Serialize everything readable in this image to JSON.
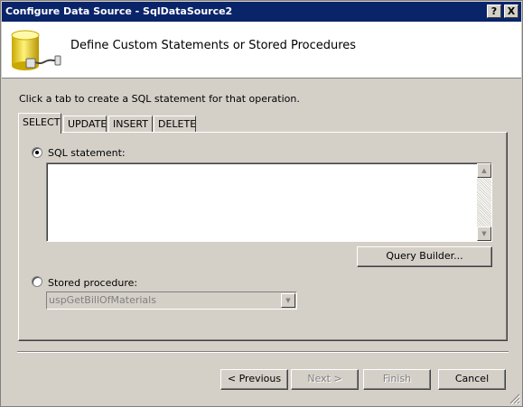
{
  "window": {
    "title": "Configure Data Source - SqlDataSource2",
    "help_label": "?",
    "close_label": "X"
  },
  "header": {
    "heading": "Define Custom Statements or Stored Procedures",
    "icon": "database-connection-icon"
  },
  "instruction": "Click a tab to create a SQL statement for that operation.",
  "tabs": [
    {
      "label": "SELECT",
      "active": true
    },
    {
      "label": "UPDATE",
      "active": false
    },
    {
      "label": "INSERT",
      "active": false
    },
    {
      "label": "DELETE",
      "active": false
    }
  ],
  "sql_option": {
    "label": "SQL statement:",
    "selected": true,
    "value": ""
  },
  "query_builder_label": "Query Builder...",
  "stored_proc_option": {
    "label": "Stored procedure:",
    "selected": false,
    "selected_value": "uspGetBillOfMaterials"
  },
  "footer": {
    "previous_label": "< Previous",
    "next_label": "Next >",
    "finish_label": "Finish",
    "cancel_label": "Cancel"
  },
  "colors": {
    "titlebar": "#0a246a",
    "face": "#d4d0c8"
  }
}
